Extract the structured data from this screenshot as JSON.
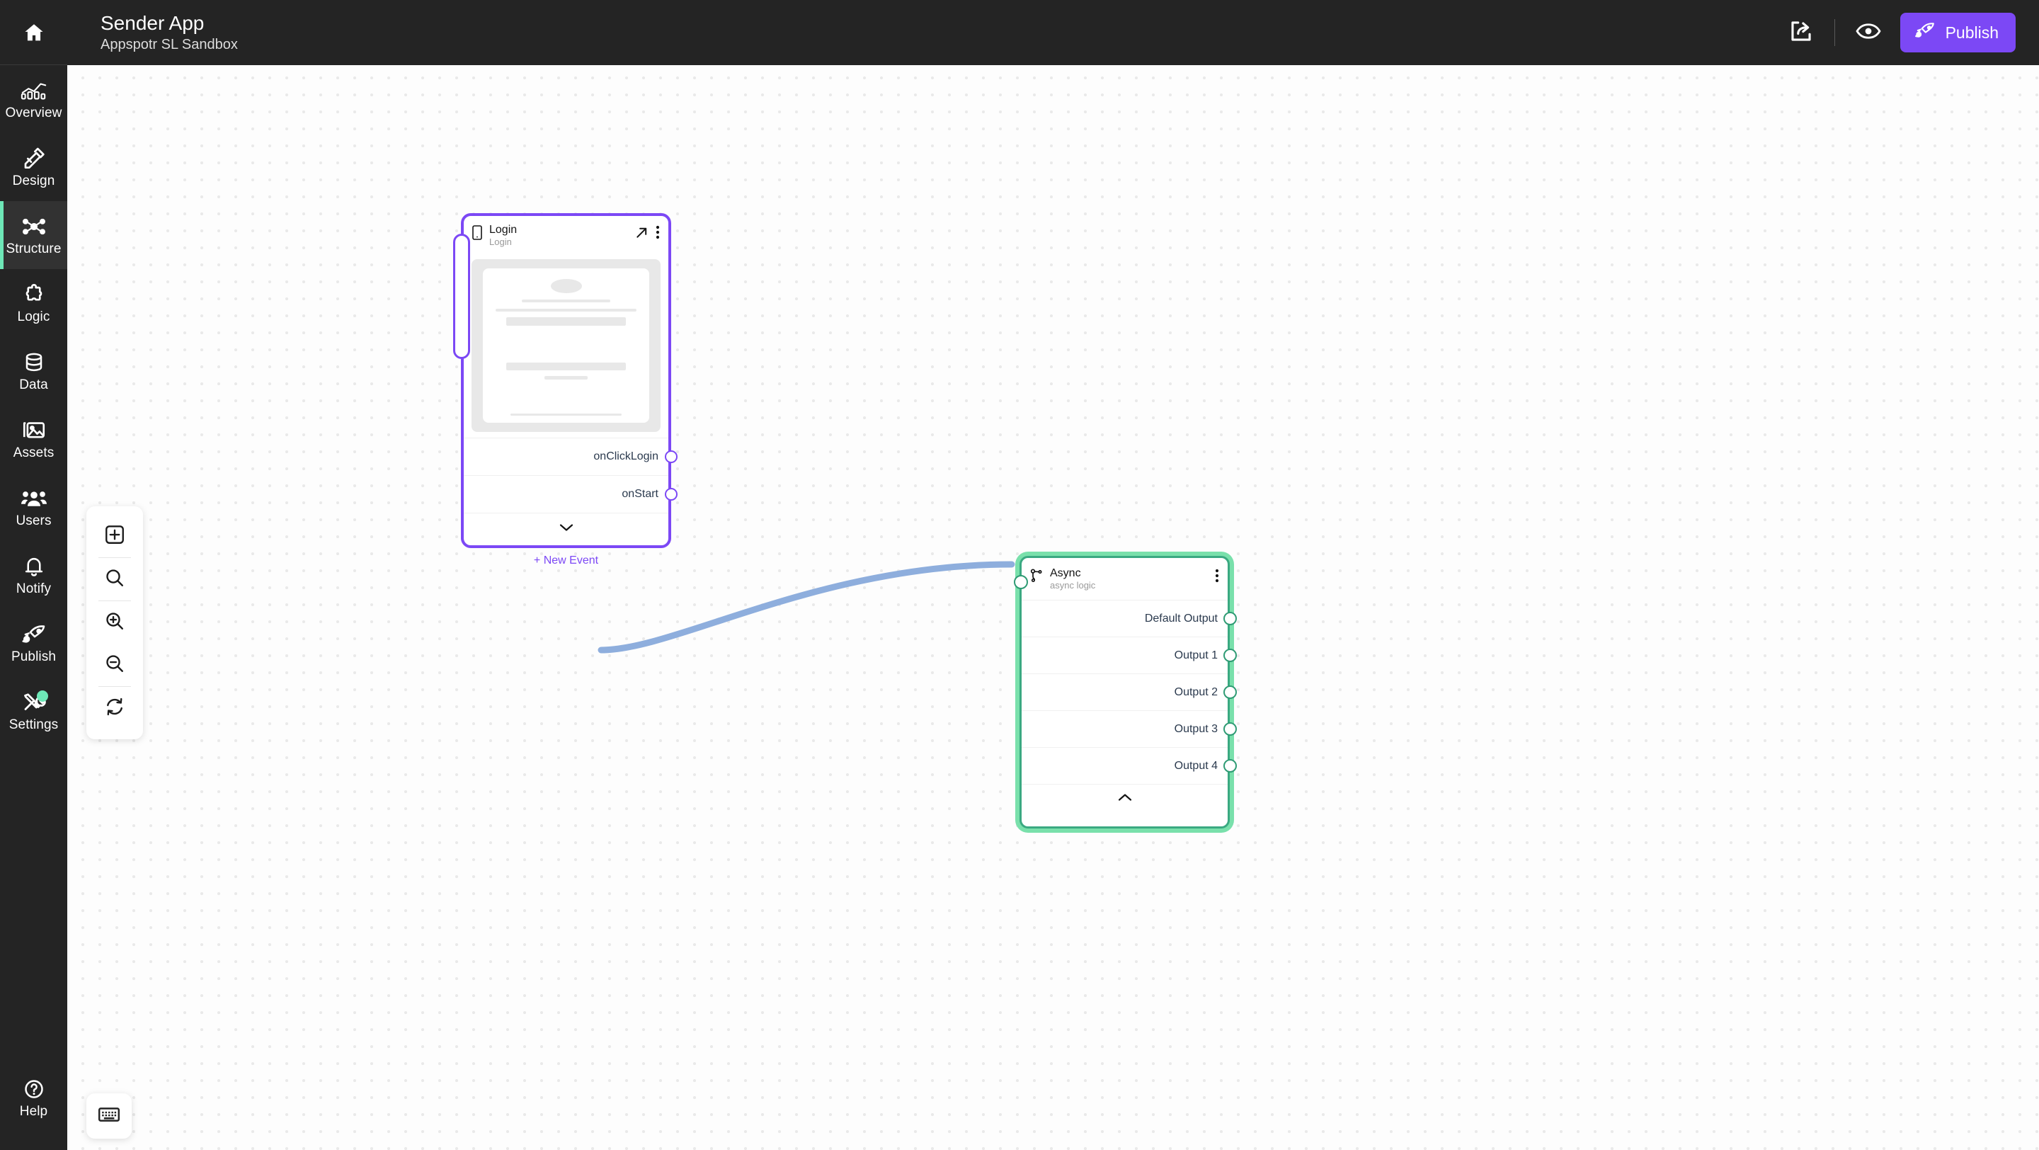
{
  "rail": {
    "home": {
      "icon": "home-icon",
      "label": "Home"
    },
    "items": [
      {
        "id": "overview",
        "label": "Overview",
        "icon": "chart-icon",
        "active": false
      },
      {
        "id": "design",
        "label": "Design",
        "icon": "pencil-ruler-icon",
        "active": false
      },
      {
        "id": "structure",
        "label": "Structure",
        "icon": "nodes-icon",
        "active": true
      },
      {
        "id": "logic",
        "label": "Logic",
        "icon": "puzzle-icon",
        "active": false
      },
      {
        "id": "data",
        "label": "Data",
        "icon": "database-icon",
        "active": false
      },
      {
        "id": "assets",
        "label": "Assets",
        "icon": "image-icon",
        "active": false
      },
      {
        "id": "users",
        "label": "Users",
        "icon": "users-icon",
        "active": false
      },
      {
        "id": "notify",
        "label": "Notify",
        "icon": "bell-icon",
        "active": false
      },
      {
        "id": "publish",
        "label": "Publish",
        "icon": "rocket-icon",
        "active": false
      },
      {
        "id": "settings",
        "label": "Settings",
        "icon": "tools-icon",
        "active": false,
        "badge": true
      }
    ],
    "help": {
      "label": "Help",
      "icon": "question-circle-icon"
    },
    "active_indicator_color": "#6ee7b7"
  },
  "topbar": {
    "title": "Sender App",
    "subtitle": "Appspotr SL Sandbox",
    "share_icon": "share-export-icon",
    "preview_icon": "eye-icon",
    "publish_label": "Publish",
    "publish_icon": "rocket-icon",
    "publish_color": "#7c48f5",
    "background": "#242424"
  },
  "toolbar": {
    "items": [
      {
        "id": "add",
        "icon": "add-box-icon",
        "label": "Add"
      },
      {
        "id": "search",
        "icon": "search-icon",
        "label": "Search"
      },
      {
        "id": "zoom-in",
        "icon": "zoom-in-icon",
        "label": "Zoom in"
      },
      {
        "id": "zoom-out",
        "icon": "zoom-out-icon",
        "label": "Zoom out"
      },
      {
        "id": "reset",
        "icon": "refresh-icon",
        "label": "Reset view"
      }
    ],
    "keyboard_shortcuts_icon": "keyboard-icon"
  },
  "canvas": {
    "grid": "dots",
    "background": "#fdfdfd",
    "dot_color": "#eaeaea"
  },
  "nodes": {
    "login": {
      "title": "Login",
      "subtitle": "Login",
      "type_icon": "mobile-screen-icon",
      "open_icon": "open-external-icon",
      "menu_icon": "more-vertical-icon",
      "border_color": "#7c48f5",
      "events": [
        {
          "label": "onClickLogin"
        },
        {
          "label": "onStart"
        }
      ],
      "collapse_icon": "chevron-down-icon",
      "new_event_label": "+ New Event"
    },
    "async": {
      "title": "Async",
      "subtitle": "async logic",
      "type_icon": "branch-icon",
      "menu_icon": "more-vertical-icon",
      "border_color": "#3aa981",
      "glow_color": "#79e0ab",
      "outputs": [
        {
          "label": "Default Output"
        },
        {
          "label": "Output 1"
        },
        {
          "label": "Output 2"
        },
        {
          "label": "Output 3"
        },
        {
          "label": "Output 4"
        }
      ],
      "collapse_icon": "chevron-up-icon"
    }
  },
  "edges": [
    {
      "from": "login.onStart",
      "to": "async.input",
      "color": "#8eaedd"
    }
  ]
}
